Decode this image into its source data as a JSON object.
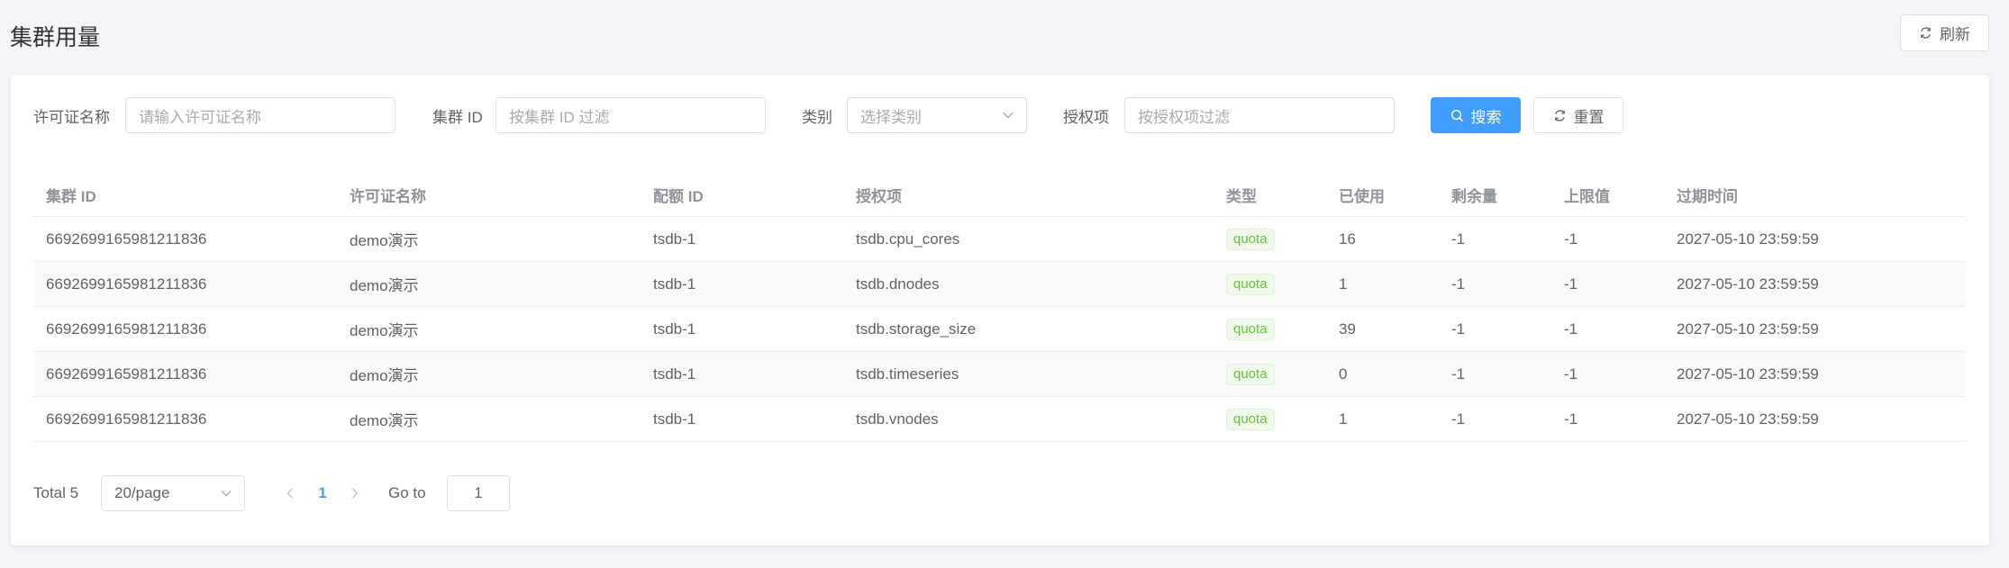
{
  "page": {
    "title": "集群用量",
    "refresh_label": "刷新"
  },
  "filters": {
    "license_name": {
      "label": "许可证名称",
      "placeholder": "请输入许可证名称"
    },
    "cluster_id": {
      "label": "集群 ID",
      "placeholder": "按集群 ID 过滤"
    },
    "category": {
      "label": "类别",
      "placeholder": "选择类别"
    },
    "grant_item": {
      "label": "授权项",
      "placeholder": "按授权项过滤"
    },
    "search_label": "搜索",
    "reset_label": "重置"
  },
  "table": {
    "columns": [
      "集群 ID",
      "许可证名称",
      "配额 ID",
      "授权项",
      "类型",
      "已使用",
      "剩余量",
      "上限值",
      "过期时间"
    ],
    "rows": [
      [
        "6692699165981211836",
        "demo演示",
        "tsdb-1",
        "tsdb.cpu_cores",
        "quota",
        "16",
        "-1",
        "-1",
        "2027-05-10 23:59:59"
      ],
      [
        "6692699165981211836",
        "demo演示",
        "tsdb-1",
        "tsdb.dnodes",
        "quota",
        "1",
        "-1",
        "-1",
        "2027-05-10 23:59:59"
      ],
      [
        "6692699165981211836",
        "demo演示",
        "tsdb-1",
        "tsdb.storage_size",
        "quota",
        "39",
        "-1",
        "-1",
        "2027-05-10 23:59:59"
      ],
      [
        "6692699165981211836",
        "demo演示",
        "tsdb-1",
        "tsdb.timeseries",
        "quota",
        "0",
        "-1",
        "-1",
        "2027-05-10 23:59:59"
      ],
      [
        "6692699165981211836",
        "demo演示",
        "tsdb-1",
        "tsdb.vnodes",
        "quota",
        "1",
        "-1",
        "-1",
        "2027-05-10 23:59:59"
      ]
    ]
  },
  "pagination": {
    "total": "Total 5",
    "page_size": "20/page",
    "current_page": "1",
    "goto_label": "Go to",
    "goto_value": "1"
  },
  "colors": {
    "primary": "#409eff",
    "tag_text": "#67c23a",
    "tag_bg": "#f0f9eb"
  }
}
